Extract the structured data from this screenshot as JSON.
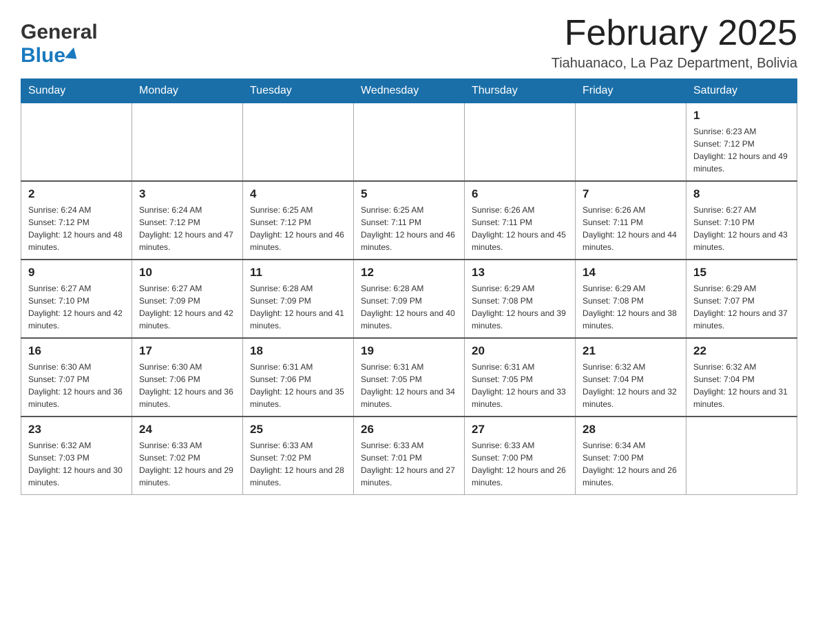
{
  "header": {
    "logo_line1": "General",
    "logo_line2": "Blue",
    "month_title": "February 2025",
    "subtitle": "Tiahuanaco, La Paz Department, Bolivia"
  },
  "days_of_week": [
    "Sunday",
    "Monday",
    "Tuesday",
    "Wednesday",
    "Thursday",
    "Friday",
    "Saturday"
  ],
  "weeks": [
    [
      {
        "day": "",
        "info": ""
      },
      {
        "day": "",
        "info": ""
      },
      {
        "day": "",
        "info": ""
      },
      {
        "day": "",
        "info": ""
      },
      {
        "day": "",
        "info": ""
      },
      {
        "day": "",
        "info": ""
      },
      {
        "day": "1",
        "info": "Sunrise: 6:23 AM\nSunset: 7:12 PM\nDaylight: 12 hours and 49 minutes."
      }
    ],
    [
      {
        "day": "2",
        "info": "Sunrise: 6:24 AM\nSunset: 7:12 PM\nDaylight: 12 hours and 48 minutes."
      },
      {
        "day": "3",
        "info": "Sunrise: 6:24 AM\nSunset: 7:12 PM\nDaylight: 12 hours and 47 minutes."
      },
      {
        "day": "4",
        "info": "Sunrise: 6:25 AM\nSunset: 7:12 PM\nDaylight: 12 hours and 46 minutes."
      },
      {
        "day": "5",
        "info": "Sunrise: 6:25 AM\nSunset: 7:11 PM\nDaylight: 12 hours and 46 minutes."
      },
      {
        "day": "6",
        "info": "Sunrise: 6:26 AM\nSunset: 7:11 PM\nDaylight: 12 hours and 45 minutes."
      },
      {
        "day": "7",
        "info": "Sunrise: 6:26 AM\nSunset: 7:11 PM\nDaylight: 12 hours and 44 minutes."
      },
      {
        "day": "8",
        "info": "Sunrise: 6:27 AM\nSunset: 7:10 PM\nDaylight: 12 hours and 43 minutes."
      }
    ],
    [
      {
        "day": "9",
        "info": "Sunrise: 6:27 AM\nSunset: 7:10 PM\nDaylight: 12 hours and 42 minutes."
      },
      {
        "day": "10",
        "info": "Sunrise: 6:27 AM\nSunset: 7:09 PM\nDaylight: 12 hours and 42 minutes."
      },
      {
        "day": "11",
        "info": "Sunrise: 6:28 AM\nSunset: 7:09 PM\nDaylight: 12 hours and 41 minutes."
      },
      {
        "day": "12",
        "info": "Sunrise: 6:28 AM\nSunset: 7:09 PM\nDaylight: 12 hours and 40 minutes."
      },
      {
        "day": "13",
        "info": "Sunrise: 6:29 AM\nSunset: 7:08 PM\nDaylight: 12 hours and 39 minutes."
      },
      {
        "day": "14",
        "info": "Sunrise: 6:29 AM\nSunset: 7:08 PM\nDaylight: 12 hours and 38 minutes."
      },
      {
        "day": "15",
        "info": "Sunrise: 6:29 AM\nSunset: 7:07 PM\nDaylight: 12 hours and 37 minutes."
      }
    ],
    [
      {
        "day": "16",
        "info": "Sunrise: 6:30 AM\nSunset: 7:07 PM\nDaylight: 12 hours and 36 minutes."
      },
      {
        "day": "17",
        "info": "Sunrise: 6:30 AM\nSunset: 7:06 PM\nDaylight: 12 hours and 36 minutes."
      },
      {
        "day": "18",
        "info": "Sunrise: 6:31 AM\nSunset: 7:06 PM\nDaylight: 12 hours and 35 minutes."
      },
      {
        "day": "19",
        "info": "Sunrise: 6:31 AM\nSunset: 7:05 PM\nDaylight: 12 hours and 34 minutes."
      },
      {
        "day": "20",
        "info": "Sunrise: 6:31 AM\nSunset: 7:05 PM\nDaylight: 12 hours and 33 minutes."
      },
      {
        "day": "21",
        "info": "Sunrise: 6:32 AM\nSunset: 7:04 PM\nDaylight: 12 hours and 32 minutes."
      },
      {
        "day": "22",
        "info": "Sunrise: 6:32 AM\nSunset: 7:04 PM\nDaylight: 12 hours and 31 minutes."
      }
    ],
    [
      {
        "day": "23",
        "info": "Sunrise: 6:32 AM\nSunset: 7:03 PM\nDaylight: 12 hours and 30 minutes."
      },
      {
        "day": "24",
        "info": "Sunrise: 6:33 AM\nSunset: 7:02 PM\nDaylight: 12 hours and 29 minutes."
      },
      {
        "day": "25",
        "info": "Sunrise: 6:33 AM\nSunset: 7:02 PM\nDaylight: 12 hours and 28 minutes."
      },
      {
        "day": "26",
        "info": "Sunrise: 6:33 AM\nSunset: 7:01 PM\nDaylight: 12 hours and 27 minutes."
      },
      {
        "day": "27",
        "info": "Sunrise: 6:33 AM\nSunset: 7:00 PM\nDaylight: 12 hours and 26 minutes."
      },
      {
        "day": "28",
        "info": "Sunrise: 6:34 AM\nSunset: 7:00 PM\nDaylight: 12 hours and 26 minutes."
      },
      {
        "day": "",
        "info": ""
      }
    ]
  ]
}
